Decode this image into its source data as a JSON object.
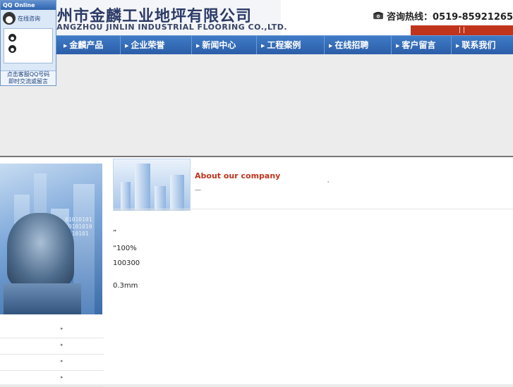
{
  "header": {
    "company_cn": "常州市金麟工业地坪有限公司",
    "company_en": "CHANGZHOU JINLIN INDUSTRIAL FLOORING CO.,LTD.",
    "hotline": "咨询热线：0519-85921265",
    "top_links": [
      "",
      "",
      ""
    ]
  },
  "nav": {
    "items": [
      {
        "label": "金麟产品"
      },
      {
        "label": "企业荣誉"
      },
      {
        "label": "新闻中心"
      },
      {
        "label": "工程案例"
      },
      {
        "label": "在线招聘"
      },
      {
        "label": "客户留言"
      },
      {
        "label": "联系我们"
      }
    ]
  },
  "qq_widget": {
    "title": "QQ Online",
    "consult_label": "在线咨询",
    "entries": [
      "",
      ""
    ],
    "footer_line1": "点击客服QQ号码",
    "footer_line2": "即时交流或留言"
  },
  "sidebar": {
    "top_glyph": "",
    "corner_glyph": "",
    "sub_glyph": "",
    "binary": "01010101\n10101010\n1010101",
    "menu": [
      {
        "label": ""
      },
      {
        "label": ""
      },
      {
        "label": ""
      },
      {
        "label": ""
      }
    ]
  },
  "about": {
    "mark": "",
    "title_cn": "",
    "title_en": "About our company",
    "title_glyph": "",
    "tiny": "³",
    "subtitle": "—  ",
    "center_mark": ""
  },
  "content": {
    "lines": [
      " ",
      "”",
      "“100%",
      " 100300 ",
      " ",
      "",
      "        ",
      "             "
    ],
    "spec_label": "",
    "spec_value": " 0.3mm"
  },
  "colors": {
    "nav_blue": "#2c5da8",
    "accent_red": "#c0341c",
    "background": "#ececec"
  }
}
